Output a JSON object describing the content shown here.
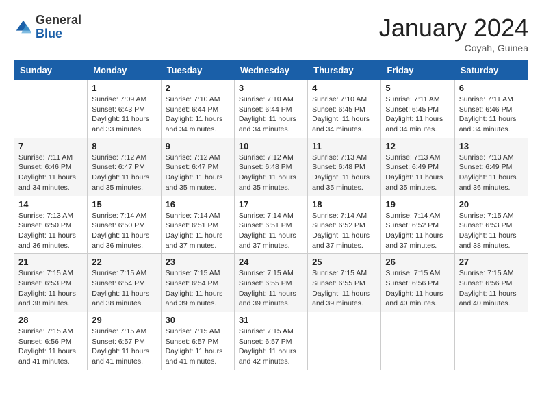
{
  "header": {
    "logo_general": "General",
    "logo_blue": "Blue",
    "month_title": "January 2024",
    "subtitle": "Coyah, Guinea"
  },
  "days_of_week": [
    "Sunday",
    "Monday",
    "Tuesday",
    "Wednesday",
    "Thursday",
    "Friday",
    "Saturday"
  ],
  "weeks": [
    [
      {
        "day": "",
        "info": ""
      },
      {
        "day": "1",
        "info": "Sunrise: 7:09 AM\nSunset: 6:43 PM\nDaylight: 11 hours\nand 33 minutes."
      },
      {
        "day": "2",
        "info": "Sunrise: 7:10 AM\nSunset: 6:44 PM\nDaylight: 11 hours\nand 34 minutes."
      },
      {
        "day": "3",
        "info": "Sunrise: 7:10 AM\nSunset: 6:44 PM\nDaylight: 11 hours\nand 34 minutes."
      },
      {
        "day": "4",
        "info": "Sunrise: 7:10 AM\nSunset: 6:45 PM\nDaylight: 11 hours\nand 34 minutes."
      },
      {
        "day": "5",
        "info": "Sunrise: 7:11 AM\nSunset: 6:45 PM\nDaylight: 11 hours\nand 34 minutes."
      },
      {
        "day": "6",
        "info": "Sunrise: 7:11 AM\nSunset: 6:46 PM\nDaylight: 11 hours\nand 34 minutes."
      }
    ],
    [
      {
        "day": "7",
        "info": "Sunrise: 7:11 AM\nSunset: 6:46 PM\nDaylight: 11 hours\nand 34 minutes."
      },
      {
        "day": "8",
        "info": "Sunrise: 7:12 AM\nSunset: 6:47 PM\nDaylight: 11 hours\nand 35 minutes."
      },
      {
        "day": "9",
        "info": "Sunrise: 7:12 AM\nSunset: 6:47 PM\nDaylight: 11 hours\nand 35 minutes."
      },
      {
        "day": "10",
        "info": "Sunrise: 7:12 AM\nSunset: 6:48 PM\nDaylight: 11 hours\nand 35 minutes."
      },
      {
        "day": "11",
        "info": "Sunrise: 7:13 AM\nSunset: 6:48 PM\nDaylight: 11 hours\nand 35 minutes."
      },
      {
        "day": "12",
        "info": "Sunrise: 7:13 AM\nSunset: 6:49 PM\nDaylight: 11 hours\nand 35 minutes."
      },
      {
        "day": "13",
        "info": "Sunrise: 7:13 AM\nSunset: 6:49 PM\nDaylight: 11 hours\nand 36 minutes."
      }
    ],
    [
      {
        "day": "14",
        "info": "Sunrise: 7:13 AM\nSunset: 6:50 PM\nDaylight: 11 hours\nand 36 minutes."
      },
      {
        "day": "15",
        "info": "Sunrise: 7:14 AM\nSunset: 6:50 PM\nDaylight: 11 hours\nand 36 minutes."
      },
      {
        "day": "16",
        "info": "Sunrise: 7:14 AM\nSunset: 6:51 PM\nDaylight: 11 hours\nand 37 minutes."
      },
      {
        "day": "17",
        "info": "Sunrise: 7:14 AM\nSunset: 6:51 PM\nDaylight: 11 hours\nand 37 minutes."
      },
      {
        "day": "18",
        "info": "Sunrise: 7:14 AM\nSunset: 6:52 PM\nDaylight: 11 hours\nand 37 minutes."
      },
      {
        "day": "19",
        "info": "Sunrise: 7:14 AM\nSunset: 6:52 PM\nDaylight: 11 hours\nand 37 minutes."
      },
      {
        "day": "20",
        "info": "Sunrise: 7:15 AM\nSunset: 6:53 PM\nDaylight: 11 hours\nand 38 minutes."
      }
    ],
    [
      {
        "day": "21",
        "info": "Sunrise: 7:15 AM\nSunset: 6:53 PM\nDaylight: 11 hours\nand 38 minutes."
      },
      {
        "day": "22",
        "info": "Sunrise: 7:15 AM\nSunset: 6:54 PM\nDaylight: 11 hours\nand 38 minutes."
      },
      {
        "day": "23",
        "info": "Sunrise: 7:15 AM\nSunset: 6:54 PM\nDaylight: 11 hours\nand 39 minutes."
      },
      {
        "day": "24",
        "info": "Sunrise: 7:15 AM\nSunset: 6:55 PM\nDaylight: 11 hours\nand 39 minutes."
      },
      {
        "day": "25",
        "info": "Sunrise: 7:15 AM\nSunset: 6:55 PM\nDaylight: 11 hours\nand 39 minutes."
      },
      {
        "day": "26",
        "info": "Sunrise: 7:15 AM\nSunset: 6:56 PM\nDaylight: 11 hours\nand 40 minutes."
      },
      {
        "day": "27",
        "info": "Sunrise: 7:15 AM\nSunset: 6:56 PM\nDaylight: 11 hours\nand 40 minutes."
      }
    ],
    [
      {
        "day": "28",
        "info": "Sunrise: 7:15 AM\nSunset: 6:56 PM\nDaylight: 11 hours\nand 41 minutes."
      },
      {
        "day": "29",
        "info": "Sunrise: 7:15 AM\nSunset: 6:57 PM\nDaylight: 11 hours\nand 41 minutes."
      },
      {
        "day": "30",
        "info": "Sunrise: 7:15 AM\nSunset: 6:57 PM\nDaylight: 11 hours\nand 41 minutes."
      },
      {
        "day": "31",
        "info": "Sunrise: 7:15 AM\nSunset: 6:57 PM\nDaylight: 11 hours\nand 42 minutes."
      },
      {
        "day": "",
        "info": ""
      },
      {
        "day": "",
        "info": ""
      },
      {
        "day": "",
        "info": ""
      }
    ]
  ]
}
